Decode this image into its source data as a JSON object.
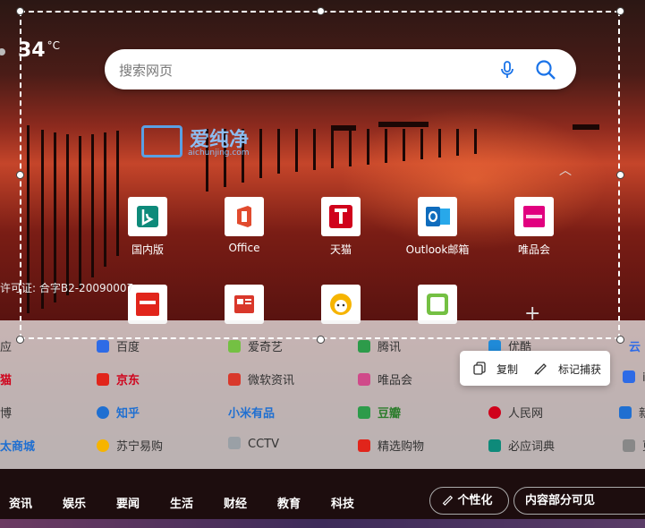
{
  "weather": {
    "temp": "34",
    "unit": "°C"
  },
  "search": {
    "placeholder": "搜索网页",
    "mic_icon": "microphone-icon",
    "search_icon": "search-icon"
  },
  "watermark": {
    "name": "爱纯净",
    "site": "aichunjing.com"
  },
  "tiles": [
    {
      "label": "国内版",
      "icon": "bing-icon",
      "color": "#0e8a7a"
    },
    {
      "label": "Office",
      "icon": "office-icon",
      "color": "#e14b2e"
    },
    {
      "label": "天猫",
      "icon": "tmall-icon",
      "color": "#d0021b"
    },
    {
      "label": "Outlook邮箱",
      "icon": "outlook-icon",
      "color": "#0f6cbd"
    },
    {
      "label": "唯品会",
      "icon": "vip-icon",
      "color": "#e1007f"
    },
    {
      "label": "",
      "icon": "jd-icon",
      "color": "#e1251b"
    },
    {
      "label": "",
      "icon": "news-icon",
      "color": "#d9382b"
    },
    {
      "label": "",
      "icon": "suning-icon",
      "color": "#f6b400"
    },
    {
      "label": "",
      "icon": "iqiyi-icon",
      "color": "#74c043"
    }
  ],
  "license": "许可证: 合字B2-20090007",
  "links": {
    "rows": [
      [
        "应",
        "百度",
        "爱奇艺",
        "腾讯",
        "优酷"
      ],
      [
        "猫",
        "京东",
        "微软资讯",
        "唯品会",
        ""
      ],
      [
        "博",
        "知乎",
        "小米有品",
        "豆瓣",
        "人民网"
      ],
      [
        "太商城",
        "苏宁易购",
        "CCTV",
        "精选购物",
        "必应词典"
      ]
    ]
  },
  "context_menu": {
    "copy": "复制",
    "annotate": "标记捕获"
  },
  "nav": {
    "items": [
      "资讯",
      "娱乐",
      "要闻",
      "生活",
      "财经",
      "教育",
      "科技"
    ],
    "personalize": "个性化",
    "visibility": "内容部分可见"
  }
}
